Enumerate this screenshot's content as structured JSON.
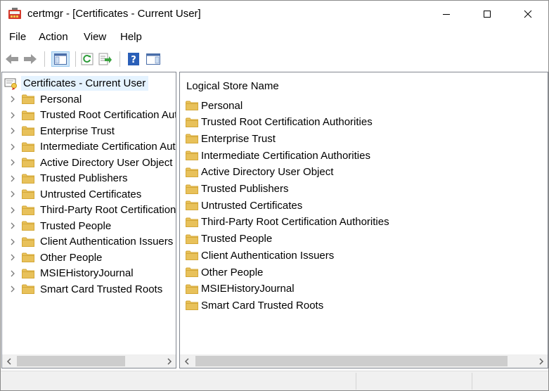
{
  "window": {
    "title": "certmgr - [Certificates - Current User]",
    "controls": [
      "minimize",
      "maximize",
      "close"
    ]
  },
  "menu": {
    "items": [
      "File",
      "Action",
      "View",
      "Help"
    ]
  },
  "toolbar": {
    "buttons": [
      {
        "icon": "back-arrow-icon"
      },
      {
        "icon": "forward-arrow-icon"
      },
      {
        "icon": "show-hide-console-tree-icon",
        "active": true
      },
      {
        "icon": "refresh-icon"
      },
      {
        "icon": "export-list-icon"
      },
      {
        "icon": "help-icon"
      },
      {
        "icon": "show-hide-action-pane-icon"
      }
    ]
  },
  "tree": {
    "root": "Certificates - Current User",
    "items": [
      "Personal",
      "Trusted Root Certification Authorities",
      "Enterprise Trust",
      "Intermediate Certification Authorities",
      "Active Directory User Object",
      "Trusted Publishers",
      "Untrusted Certificates",
      "Third-Party Root Certification Authorities",
      "Trusted People",
      "Client Authentication Issuers",
      "Other People",
      "MSIEHistoryJournal",
      "Smart Card Trusted Roots"
    ]
  },
  "list": {
    "column_header": "Logical Store Name",
    "items": [
      "Personal",
      "Trusted Root Certification Authorities",
      "Enterprise Trust",
      "Intermediate Certification Authorities",
      "Active Directory User Object",
      "Trusted Publishers",
      "Untrusted Certificates",
      "Third-Party Root Certification Authorities",
      "Trusted People",
      "Client Authentication Issuers",
      "Other People",
      "MSIEHistoryJournal",
      "Smart Card Trusted Roots"
    ]
  },
  "colors": {
    "folder": "#e8c15a",
    "folder_dark": "#d4a838",
    "selection": "#e5f3ff",
    "accent": "#1c5fb4"
  }
}
